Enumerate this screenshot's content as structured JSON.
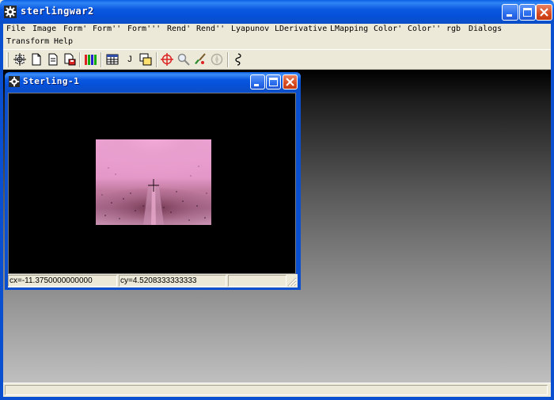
{
  "app": {
    "title": "sterlingwar2"
  },
  "menu": {
    "row1": [
      "File",
      "Image",
      "Form'",
      "Form''",
      "Form'''",
      "Rend'",
      "Rend''",
      "Lyapunov",
      "LDerivative",
      "LMapping",
      "Color'",
      "Color''",
      "rgb",
      "Dialogs"
    ],
    "row2": [
      "Transform",
      "Help"
    ]
  },
  "toolbar": {
    "icons": [
      "capture-icon",
      "new-document-icon",
      "copy-document-icon",
      "save-export-icon",
      "color-bars-icon",
      "table-icon",
      "j-icon",
      "window-copy-icon",
      "crosshair-icon",
      "zoom-icon",
      "brush-icon",
      "disabled-compass-icon",
      "spiral-icon"
    ],
    "j_label": "J"
  },
  "child": {
    "title": "Sterling-1",
    "status_cx": "cx=-11.3750000000000",
    "status_cy": "cy=4.5208333333333"
  }
}
